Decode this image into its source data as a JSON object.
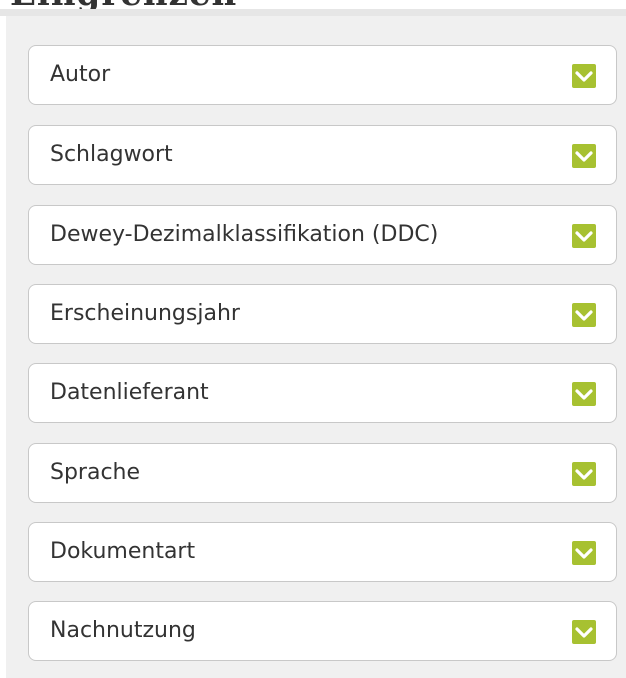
{
  "sidebar": {
    "heading": "Eingrenzen",
    "facets": [
      {
        "label": "Autor",
        "icon": "chevron-down-icon"
      },
      {
        "label": "Schlagwort",
        "icon": "chevron-down-icon"
      },
      {
        "label": "Dewey-Dezimalklassifikation (DDC)",
        "icon": "chevron-down-icon"
      },
      {
        "label": "Erscheinungsjahr",
        "icon": "chevron-down-icon"
      },
      {
        "label": "Datenlieferant",
        "icon": "chevron-down-icon"
      },
      {
        "label": "Sprache",
        "icon": "chevron-down-icon"
      },
      {
        "label": "Dokumentart",
        "icon": "chevron-down-icon"
      },
      {
        "label": "Nachnutzung",
        "icon": "chevron-down-icon"
      }
    ]
  },
  "colors": {
    "accent": "#a7c131",
    "panel_background": "#f0f0f0",
    "box_border": "#c8c8c8",
    "text": "#333333"
  }
}
